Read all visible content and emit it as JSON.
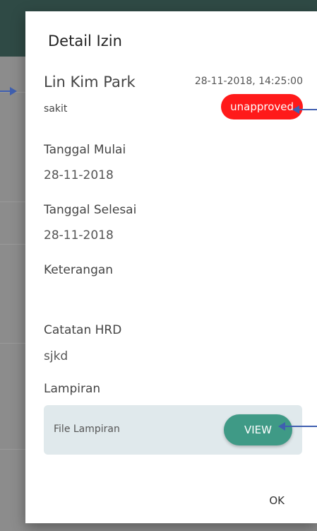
{
  "dialog": {
    "title": "Detail Izin",
    "employee_name": "Lin Kim Park",
    "submitted_at": "28-11-2018, 14:25:00",
    "reason": "sakit",
    "status": "unapproved",
    "status_color": "#ff1a1a",
    "start_label": "Tanggal Mulai",
    "start_value": "28-11-2018",
    "end_label": "Tanggal Selesai",
    "end_value": "28-11-2018",
    "notes_label": "Keterangan",
    "notes_value": "",
    "hrd_label": "Catatan HRD",
    "hrd_value": "sjkd",
    "attachment_label": "Lampiran",
    "attachment_file_label": "File Lampiran",
    "view_label": "VIEW",
    "ok_label": "OK",
    "accent": "#3f9a86"
  }
}
